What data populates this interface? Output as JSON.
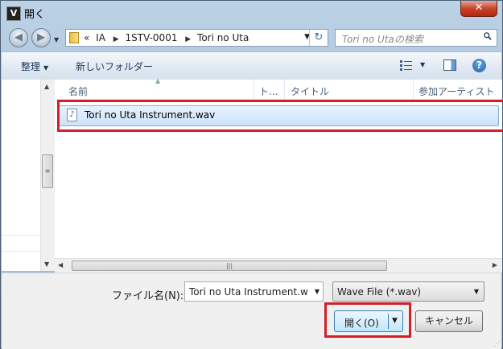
{
  "window": {
    "title": "開く",
    "app_icon_letter": "V",
    "close_glyph": "✕"
  },
  "address": {
    "overflow": "«",
    "crumbs": [
      "IA",
      "1STV-0001",
      "Tori no Uta"
    ]
  },
  "search": {
    "placeholder": "Tori no Utaの検索"
  },
  "toolbar": {
    "organize_label": "整理",
    "new_folder_label": "新しいフォルダー"
  },
  "columns": {
    "name": "名前",
    "track": "ト...",
    "title": "タイトル",
    "artist": "参加アーティスト"
  },
  "files": [
    {
      "name": "Tori no Uta Instrument.wav",
      "icon": "wav-audio-icon",
      "selected": true
    }
  ],
  "bottom": {
    "filename_label": "ファイル名(N):",
    "filename_value": "Tori no Uta Instrument.w",
    "filetype_value": "Wave File (*.wav)",
    "open_label": "開く(O)",
    "cancel_label": "キャンセル"
  },
  "colors": {
    "highlight": "#d21f2b",
    "selection": "#cce3fb",
    "toolbar_text": "#1e395b"
  }
}
